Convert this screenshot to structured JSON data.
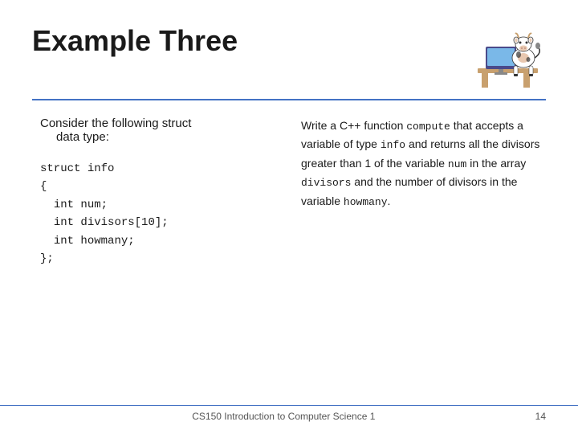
{
  "slide": {
    "title": "Example Three",
    "divider_color": "#4472c4",
    "left": {
      "consider_label": "Consider the following struct",
      "consider_label2": "data type:",
      "code_lines": [
        "struct info",
        "{",
        "  int num;",
        "  int divisors[10];",
        "  int howmany;",
        "};"
      ]
    },
    "right": {
      "text_parts": [
        {
          "type": "normal",
          "text": "Write a C++ function "
        },
        {
          "type": "code",
          "text": "compute"
        },
        {
          "type": "normal",
          "text": " that accepts a variable of type "
        },
        {
          "type": "code",
          "text": "info"
        },
        {
          "type": "normal",
          "text": " and returns all the divisors greater than 1 of the variable "
        },
        {
          "type": "code",
          "text": "num"
        },
        {
          "type": "normal",
          "text": " in the array "
        },
        {
          "type": "code",
          "text": "divisors"
        },
        {
          "type": "normal",
          "text": " and the number of divisors in the variable "
        },
        {
          "type": "code",
          "text": "howmany"
        },
        {
          "type": "normal",
          "text": "."
        }
      ]
    },
    "footer": {
      "course": "CS150 Introduction to Computer Science 1",
      "page": "14"
    }
  }
}
